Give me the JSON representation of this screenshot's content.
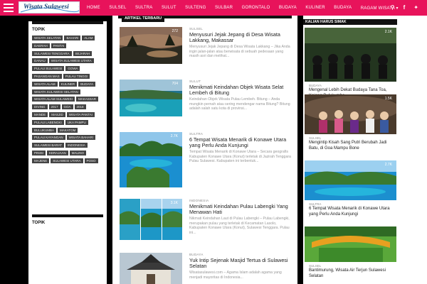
{
  "header": {
    "logo_text": "Wisata Sulawesi",
    "nav": [
      "HOME",
      "SULSEL",
      "SULTRA",
      "SULUT",
      "SULTENG",
      "SULBAR",
      "GORONTALO",
      "BUDAYA",
      "KULINER",
      "BUDAYA",
      "RAGAM WISATA ▾"
    ],
    "icons": [
      "search-icon",
      "facebook-icon",
      "twitter-icon"
    ]
  },
  "sidebar": {
    "topik_title": "TOPIK",
    "tags": [
      "WISATA SELATAN",
      "BAHARI",
      "ALAM",
      "DAERAH",
      "PANTAI",
      "SULAWESI TENGGARA",
      "SEJARAH",
      "DANAU",
      "WISATA SULAWESI UTARA",
      "PULAU SULAWESI",
      "GOWA",
      "PASANGAN MAS",
      "PULAU TINGGI",
      "WISATA ALAM",
      "KULINER",
      "BUDAYA",
      "WISATA SULAWESI SELATAN",
      "WISATA ALAM SULAWESI",
      "MAKASSAR",
      "DIVING",
      "2017",
      "GOA",
      "2018",
      "MANDE",
      "MASJID",
      "WISATA PANTAI",
      "PULAU LABENGKI",
      "UKA PAMPU",
      "BULUKUMBA",
      "MAKATOM",
      "PULAU KAYANGAN",
      "WISATA BAHARI",
      "SULAWESI BARAT",
      "INDONESIA",
      "PINISI",
      "KERAJAAN",
      "MALINO",
      "MAJENE",
      "SULAWESI UTARA",
      "POSO"
    ],
    "topik2_title": "TOPIK"
  },
  "main": {
    "section_title": "ARTIKEL TERBARU",
    "posts": [
      {
        "cat": "SULSEL",
        "title": "Menyusuri Jejak Jepang di Desa Wisata Lakkang, Makassar",
        "excerpt": "Menyusuri Jejak Jepang di Desa Wisata Lakkang – Jika Anda ingin jalan-jalan atau berwisata di sebuah pedesaan yang masih asri dan melihat...",
        "count": "272"
      },
      {
        "cat": "SULUT",
        "title": "Menikmati Keindahan Objek Wisata Selat Lembeh di Bitung",
        "excerpt": "Keindahan Objek Wisata Pulau Lembeh. Bitung – Anda mungkin pernah atau sering mendengar nama Bitung? Bitung adalah salah satu kota di provinsi...",
        "count": "704"
      },
      {
        "cat": "SULTRA",
        "title": "6 Tempat Wisata Menarik di Konawe Utara yang Perlu Anda Kunjungi",
        "excerpt": "Tempat Wisata Menarik di Konawe Utara – Secara geografis Kabupaten Konawe Utara (Konut) terletak di Jazirah Tenggara Pulau Sulawesi. Kabupaten ini terbentuk...",
        "count": "2.7K"
      },
      {
        "cat": "INDONESIA",
        "title": "Menikmati Keindahan Pulau Labengki Yang Menawan Hati",
        "excerpt": "Nikmati Keindahan Laut di Pulau Labengki – Pulau Labengki, merupakan pulau yang terletak di Kecamatan Lasolo, Kabupaten Konawe Utara (Konut), Sulawesi Tenggara. Pulau ini...",
        "count": "3.1K"
      },
      {
        "cat": "BUDAYA",
        "title": "Yuk Intip Sejenak Masjid Tertua di Sulawesi Selatan",
        "excerpt": "Wisatasulawesi.com – Agama Islam adalah agama yang menjadi mayoritas di Indonesia...",
        "count": ""
      }
    ]
  },
  "right": {
    "section_title": "KALIAN HARUS SIMAK",
    "cards": [
      {
        "cat": "BUDAYA",
        "title": "Mengenal Lebih Dekat Budaya Tana Toa, Kajang Bulukumba",
        "count": "2.1K"
      },
      {
        "cat": "SULSEL",
        "title": "Mengintip Kisah Sang Putri Berubah Jadi Batu, di Goa Mampu Bone",
        "count": "1.5K"
      },
      {
        "cat": "SULTRA",
        "title": "6 Tempat Wisata Menarik di Konawe Utara yang Perlu Anda Kunjungi",
        "count": "2.7K"
      },
      {
        "cat": "SULSEL",
        "title": "Bantimurung, Wisata Air Terjun Sulawesi Selatan",
        "count": ""
      }
    ]
  },
  "colors": {
    "accent": "#e8135b",
    "dark": "#111111"
  }
}
